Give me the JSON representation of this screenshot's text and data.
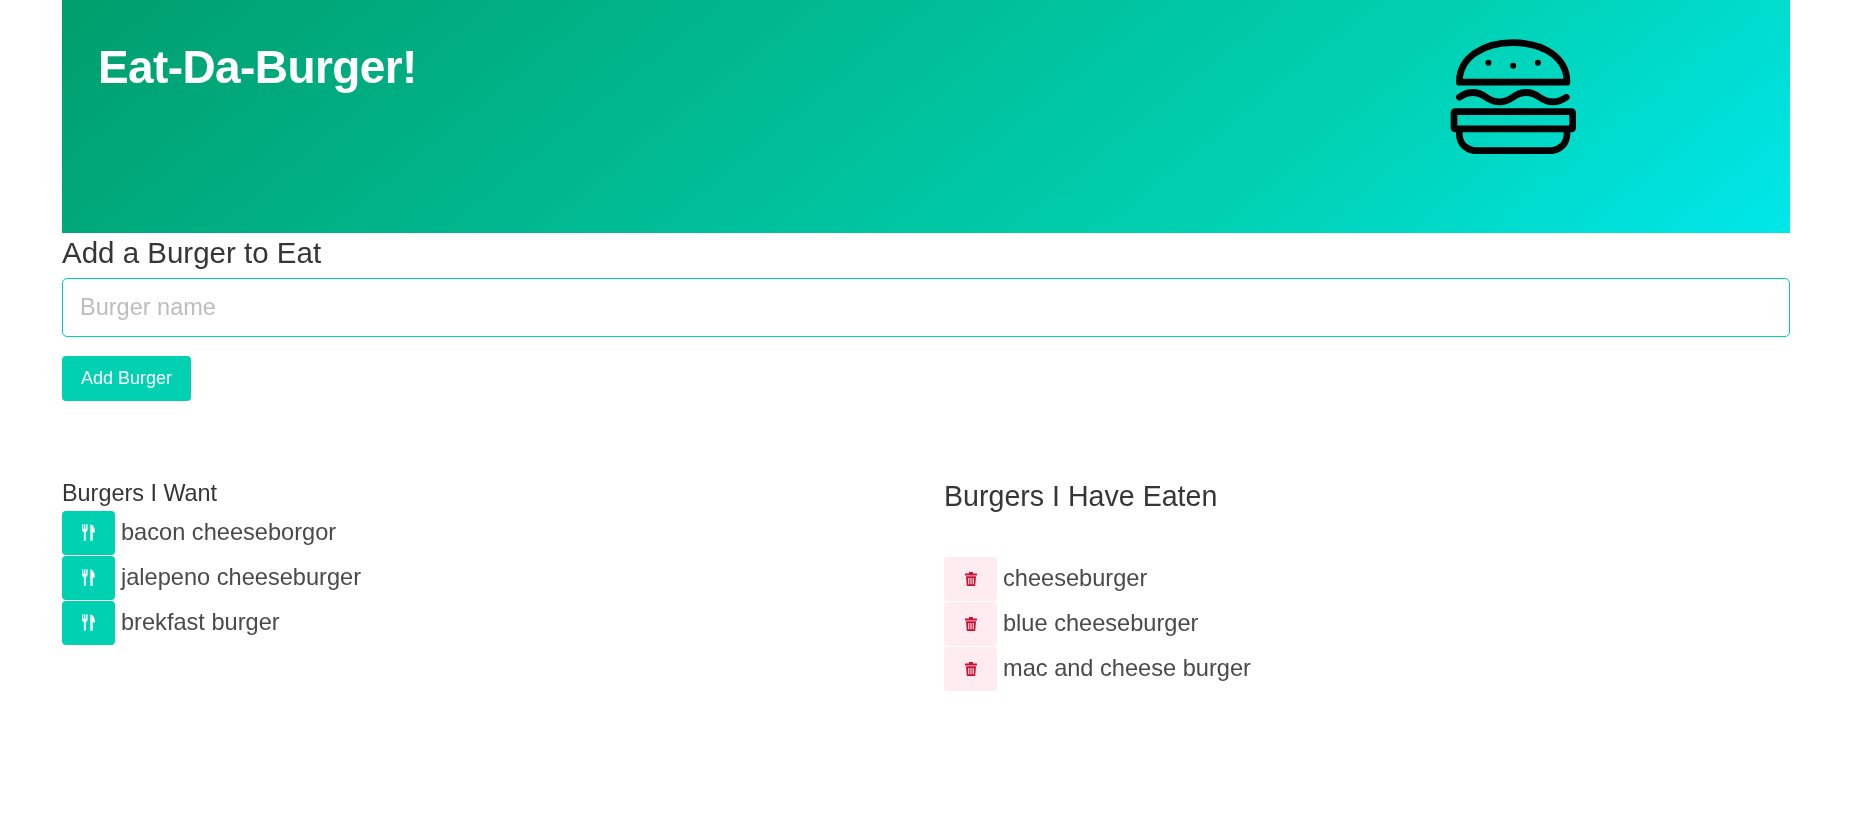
{
  "header": {
    "title": "Eat-Da-Burger!"
  },
  "form": {
    "heading": "Add a Burger to Eat",
    "input": {
      "placeholder": "Burger name"
    },
    "button": "Add Burger"
  },
  "lists": [
    {
      "heading": "Burgers I Want",
      "kind": "to-eat",
      "items": [
        "bacon cheeseborgor",
        "jalepeno cheeseburger",
        "brekfast burger"
      ]
    },
    {
      "heading": "Burgers I Have Eaten",
      "kind": "eaten",
      "items": [
        "cheeseburger",
        "blue cheeseburger",
        "mac and cheese burger"
      ]
    }
  ]
}
